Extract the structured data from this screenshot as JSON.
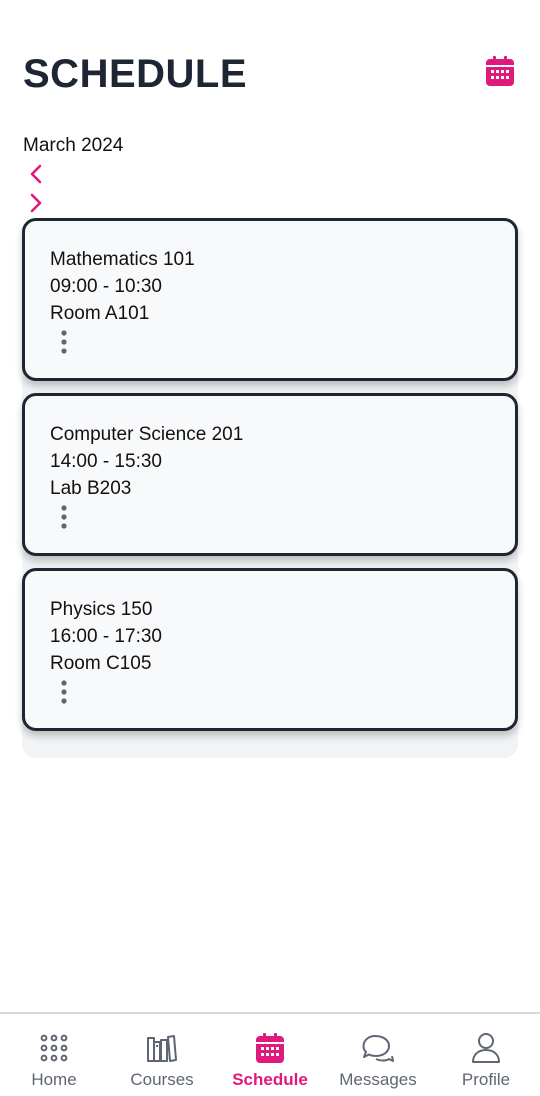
{
  "header": {
    "title": "SCHEDULE"
  },
  "calendar": {
    "month_label": "March 2024"
  },
  "classes": [
    {
      "name": "Mathematics 101",
      "time": "09:00 - 10:30",
      "room": "Room A101"
    },
    {
      "name": "Computer Science 201",
      "time": "14:00 - 15:30",
      "room": "Lab B203"
    },
    {
      "name": "Physics 150",
      "time": "16:00 - 17:30",
      "room": "Room C105"
    }
  ],
  "bottom_nav": {
    "items": [
      {
        "label": "Home",
        "icon": "grid-icon"
      },
      {
        "label": "Courses",
        "icon": "books-icon"
      },
      {
        "label": "Schedule",
        "icon": "calendar-icon",
        "active": true
      },
      {
        "label": "Messages",
        "icon": "chat-icon"
      },
      {
        "label": "Profile",
        "icon": "person-icon"
      }
    ]
  },
  "colors": {
    "accent": "#e0197d",
    "text_dark": "#1e2533",
    "nav_inactive": "#5f6673"
  }
}
